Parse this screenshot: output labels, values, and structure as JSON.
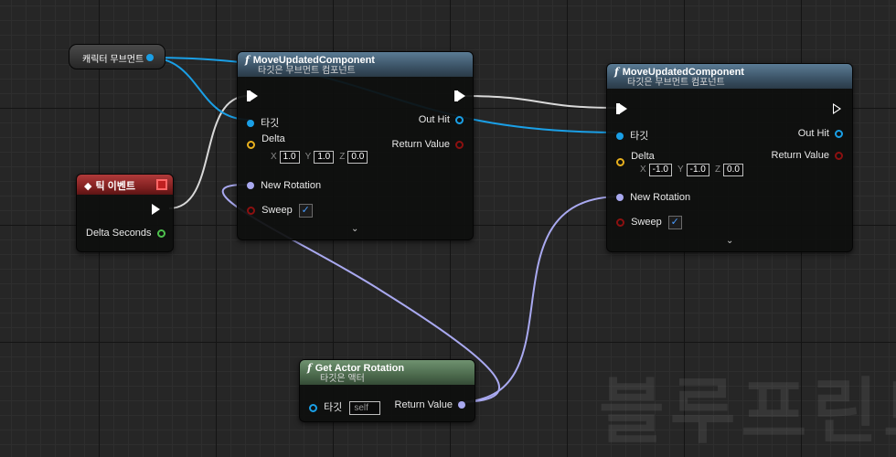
{
  "watermark": "블루프린트",
  "colors": {
    "exec_wire": "#d9d9d9",
    "object_wire": "#1a9fe6",
    "rotator_wire": "#a9a9f0"
  },
  "component_var": {
    "label": "캐릭터 무브먼트"
  },
  "tick_event": {
    "title": "틱 이벤트",
    "delta_seconds": "Delta Seconds"
  },
  "move1": {
    "title": "MoveUpdatedComponent",
    "subtitle": "타깃은 무브먼트 컴포넌트",
    "target": "타깃",
    "out_hit": "Out Hit",
    "delta": "Delta",
    "return_value": "Return Value",
    "delta_x": "1.0",
    "delta_y": "1.0",
    "delta_z": "0.0",
    "new_rotation": "New Rotation",
    "sweep": "Sweep",
    "sweep_checked": true
  },
  "move2": {
    "title": "MoveUpdatedComponent",
    "subtitle": "타깃은 무브먼트 컴포넌트",
    "target": "타깃",
    "out_hit": "Out Hit",
    "delta": "Delta",
    "return_value": "Return Value",
    "delta_x": "-1.0",
    "delta_y": "-1.0",
    "delta_z": "0.0",
    "new_rotation": "New Rotation",
    "sweep": "Sweep",
    "sweep_checked": true
  },
  "get_rotation": {
    "title": "Get Actor Rotation",
    "subtitle": "타깃은 액터",
    "target": "타깃",
    "self": "self",
    "return_value": "Return Value"
  },
  "axis": {
    "x": "X",
    "y": "Y",
    "z": "Z"
  },
  "icons": {
    "function": "function-icon",
    "event": "event-diamond-icon",
    "expand": "chevron-down-icon"
  }
}
